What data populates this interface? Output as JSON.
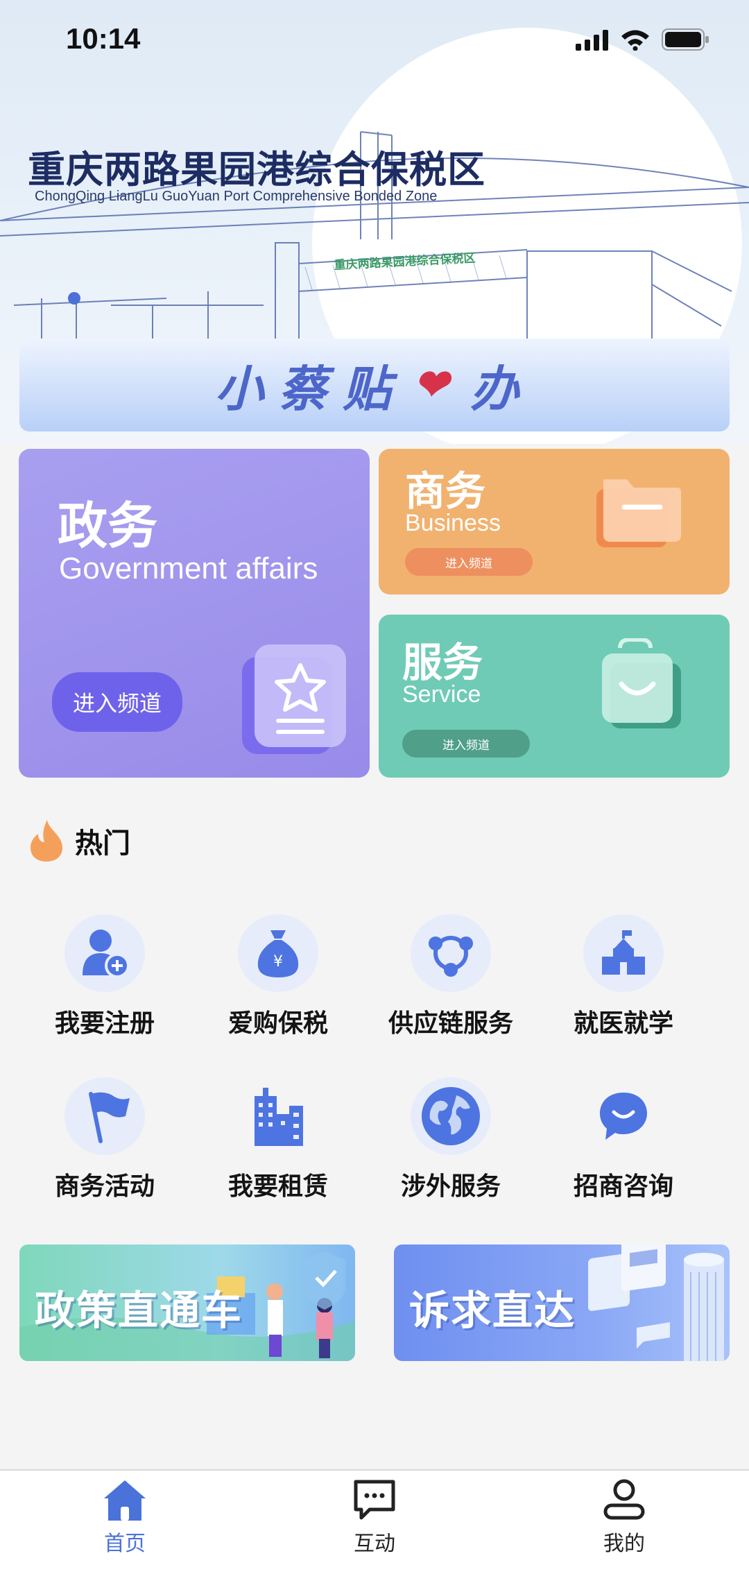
{
  "status_bar": {
    "time": "10:14"
  },
  "hero": {
    "title": "重庆两路果园港综合保税区",
    "subtitle": "ChongQing LiangLu GuoYuan Port Comprehensive Bonded Zone",
    "gate_sign": "重庆两路果园港综合保税区",
    "slogan_part1": "小蔡贴",
    "slogan_part2": "办"
  },
  "channels": {
    "government": {
      "title": "政务",
      "subtitle": "Government affairs",
      "button": "进入频道",
      "icon": "star-badge-icon",
      "color": "#9d92ec"
    },
    "business": {
      "title": "商务",
      "subtitle": "Business",
      "button": "进入频道",
      "icon": "folder-icon",
      "color": "#f1b26f"
    },
    "service": {
      "title": "服务",
      "subtitle": "Service",
      "button": "进入频道",
      "icon": "shopping-bag-icon",
      "color": "#6fcbb6"
    }
  },
  "hot": {
    "title": "热门",
    "icon": "flame-icon",
    "items": [
      {
        "label": "我要注册",
        "icon": "user-add-icon"
      },
      {
        "label": "爱购保税",
        "icon": "money-bag-icon"
      },
      {
        "label": "供应链服务",
        "icon": "network-icon"
      },
      {
        "label": "就医就学",
        "icon": "school-icon"
      },
      {
        "label": "商务活动",
        "icon": "flag-icon"
      },
      {
        "label": "我要租赁",
        "icon": "buildings-icon"
      },
      {
        "label": "涉外服务",
        "icon": "globe-icon"
      },
      {
        "label": "招商咨询",
        "icon": "chat-smile-icon"
      }
    ]
  },
  "promos": {
    "left": "政策直通车",
    "right": "诉求直达"
  },
  "tab_bar": {
    "tabs": [
      {
        "label": "首页",
        "icon": "home-icon",
        "active": true
      },
      {
        "label": "互动",
        "icon": "message-icon",
        "active": false
      },
      {
        "label": "我的",
        "icon": "profile-icon",
        "active": false
      }
    ]
  },
  "colors": {
    "accent": "#4a72d9",
    "hot_flame": "#f5a05a"
  }
}
